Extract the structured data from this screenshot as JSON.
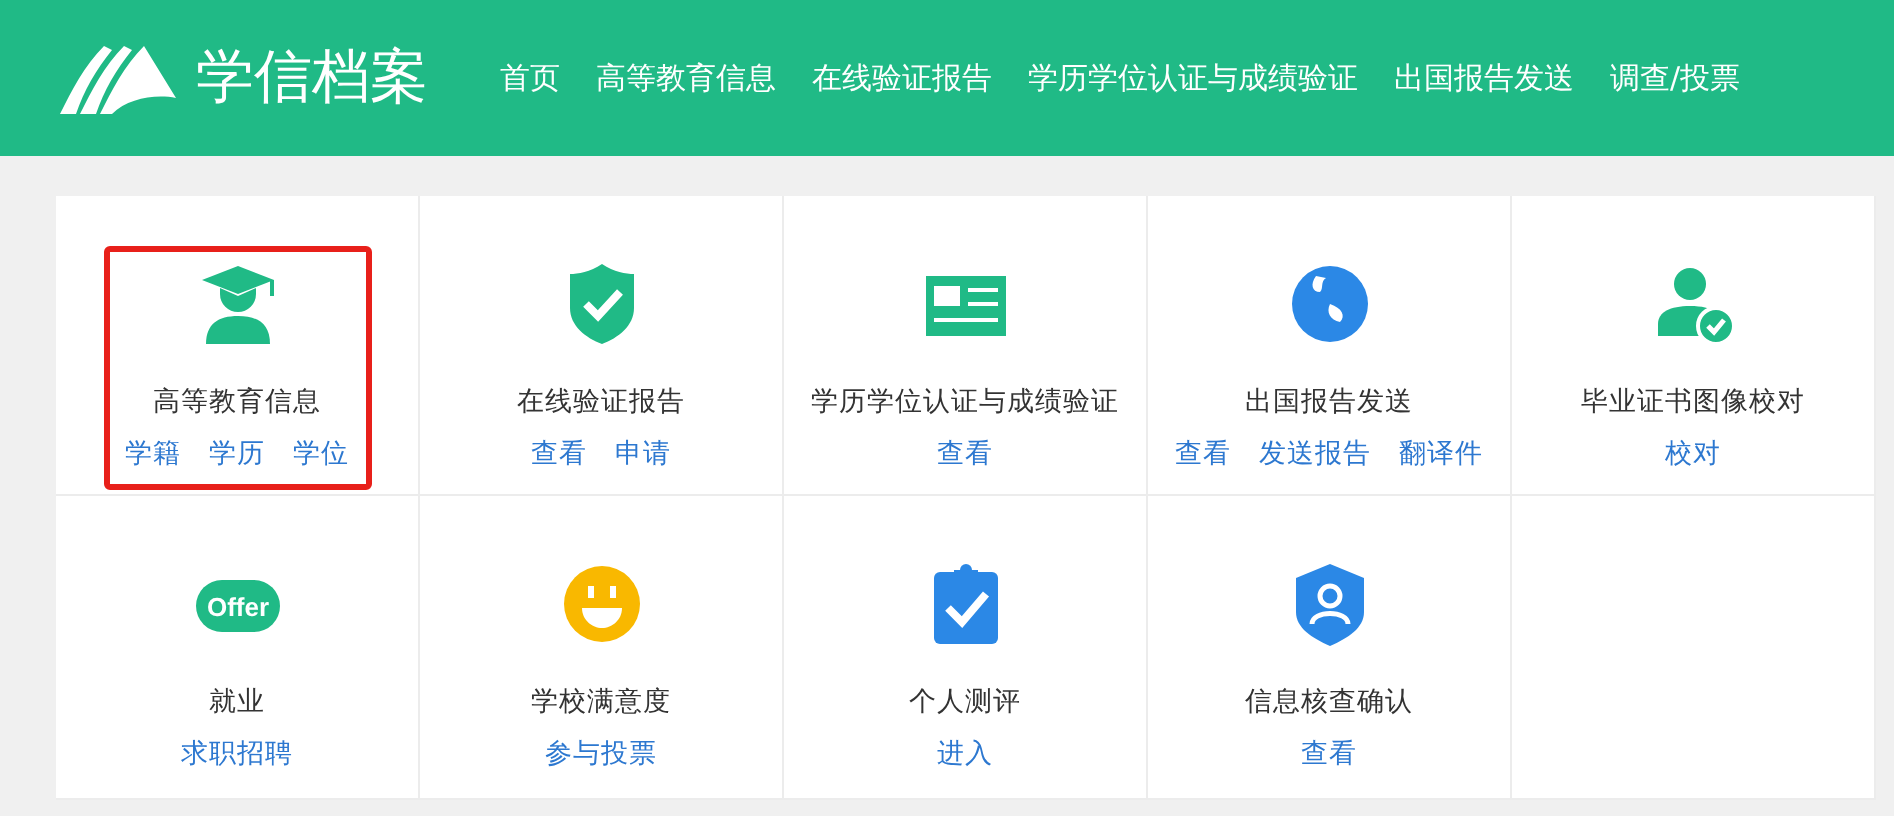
{
  "header": {
    "logo_text": "学信档案",
    "nav": [
      {
        "label": "首页"
      },
      {
        "label": "高等教育信息"
      },
      {
        "label": "在线验证报告"
      },
      {
        "label": "学历学位认证与成绩验证"
      },
      {
        "label": "出国报告发送"
      },
      {
        "label": "调查/投票"
      }
    ]
  },
  "services": [
    {
      "title": "高等教育信息",
      "links": [
        "学籍",
        "学历",
        "学位"
      ],
      "highlighted": true
    },
    {
      "title": "在线验证报告",
      "links": [
        "查看",
        "申请"
      ],
      "highlighted": false
    },
    {
      "title": "学历学位认证与成绩验证",
      "links": [
        "查看"
      ],
      "highlighted": false
    },
    {
      "title": "出国报告发送",
      "links": [
        "查看",
        "发送报告",
        "翻译件"
      ],
      "highlighted": false
    },
    {
      "title": "毕业证书图像校对",
      "links": [
        "校对"
      ],
      "highlighted": false
    },
    {
      "badge": "Offer",
      "title": "就业",
      "links": [
        "求职招聘"
      ],
      "highlighted": false
    },
    {
      "title": "学校满意度",
      "links": [
        "参与投票"
      ],
      "highlighted": false
    },
    {
      "title": "个人测评",
      "links": [
        "进入"
      ],
      "highlighted": false
    },
    {
      "title": "信息核查确认",
      "links": [
        "查看"
      ],
      "highlighted": false
    }
  ]
}
